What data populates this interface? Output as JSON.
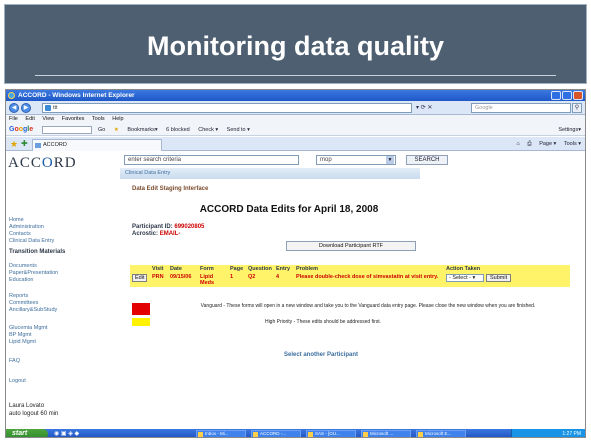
{
  "slide": {
    "title": "Monitoring data quality"
  },
  "browser": {
    "window_title": "ACCORD - Windows Internet Explorer",
    "address": "ttt",
    "search_placeholder": "Google",
    "menu": [
      "File",
      "Edit",
      "View",
      "Favorites",
      "Tools",
      "Help"
    ],
    "google_label": "Google",
    "toolbar_items": [
      "Go",
      "Bookmarks▾",
      "6 blocked",
      "Check ▾",
      "Send to ▾"
    ],
    "toolbar_settings": "Settings▾",
    "tab_title": "ACCORD",
    "command_items": [
      "Page ▾",
      "Tools ▾"
    ]
  },
  "app": {
    "logo_left": "ACC",
    "logo_accent": "O",
    "logo_right": "RD",
    "search_value": "enter search criteria",
    "search_select": "mop",
    "search_button": "SEARCH",
    "subnav": "Clinical Data Entry",
    "sidebar": [
      "Home",
      "Administration",
      "Contacts",
      "Clinical Data Entry",
      "Transition Materials",
      "Documents",
      "Paper&Presentation",
      "Education",
      "Reports",
      "Committees",
      "Ancillary&SubStudy",
      "Glucemia Mgmt",
      "BP Mgmt",
      "Lipid Mgmt",
      "FAQ",
      "Logout"
    ],
    "user_name": "Laura Lovato",
    "user_logout": "auto logout 60 min",
    "section_title": "Data Edit Staging Interface",
    "heading": "ACCORD Data Edits for April 18, 2008",
    "participant_label": "Participant ID:",
    "participant_id": "699020805",
    "acrostic_label": "Acrostic:",
    "acrostic_value": "EMAIL-",
    "download_button": "Download Participant RTF",
    "table": {
      "headers": [
        "",
        "Visit",
        "Date",
        "Form",
        "Page",
        "Question",
        "Entry",
        "Problem",
        "Action Taken"
      ],
      "row": {
        "edit_label": "Edit",
        "visit": "PRN",
        "date": "09/15/06",
        "form": "Lipid Meds",
        "page": "1",
        "question": "Q2",
        "entry": "4",
        "problem": "Please double-check dose of simvastatin at visit entry.",
        "action_select": "- Select -",
        "submit_label": "Submit"
      }
    },
    "legend_red": "Vanguard - These forms will open in a new window and take you to the Vanguard data entry page. Please close the new window when you are finished.",
    "legend_yellow": "High Priority - These edits should be addressed first.",
    "select_another": "Select another Participant"
  },
  "taskbar": {
    "start": "start",
    "tasks": [
      "Inbox - Mi...",
      "ACCORD -...",
      "SAS - [OU...",
      "Microsoft ...",
      "Microsoft E..."
    ],
    "clock": "1:27 PM"
  },
  "colors": {
    "slide_header": "#4d5f70",
    "highlight_yellow": "#fff36a",
    "vanguard_red": "#e30000",
    "link_blue": "#3c6e9e"
  }
}
